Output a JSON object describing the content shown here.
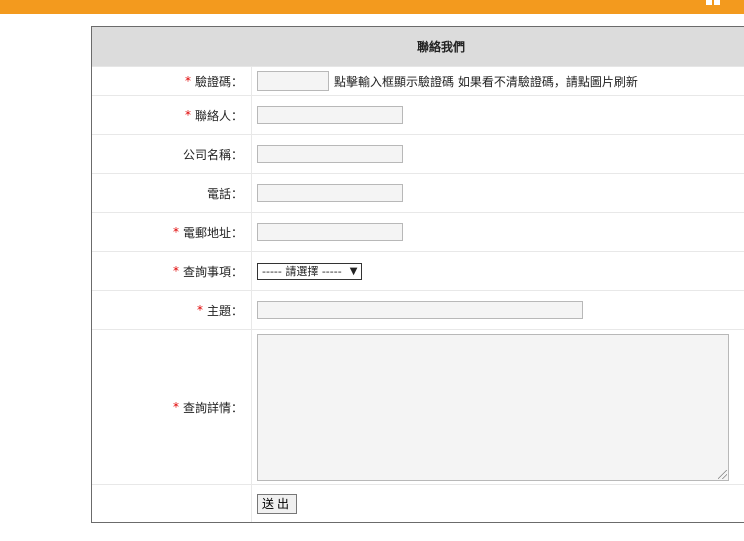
{
  "form": {
    "title": "聯絡我們",
    "fields": {
      "captcha": {
        "required": "*",
        "label": "驗證碼：",
        "value": "",
        "hint": "點擊輸入框顯示驗證碼 如果看不清驗證碼，請點圖片刷新"
      },
      "contact": {
        "required": "*",
        "label": "聯絡人：",
        "value": ""
      },
      "company": {
        "label": "公司名稱：",
        "value": ""
      },
      "phone": {
        "label": "電話：",
        "value": ""
      },
      "email": {
        "required": "*",
        "label": "電郵地址：",
        "value": ""
      },
      "inquiry_type": {
        "required": "*",
        "label": "查詢事項：",
        "selected": "----- 請選擇 -----"
      },
      "subject": {
        "required": "*",
        "label": "主題：",
        "value": ""
      },
      "details": {
        "required": "*",
        "label": "查詢詳情：",
        "value": ""
      }
    },
    "submit_label": "送出"
  },
  "colors": {
    "top_bar": "#f39a1e",
    "header_bg": "#dcdcdc",
    "required_mark": "#e00000"
  }
}
